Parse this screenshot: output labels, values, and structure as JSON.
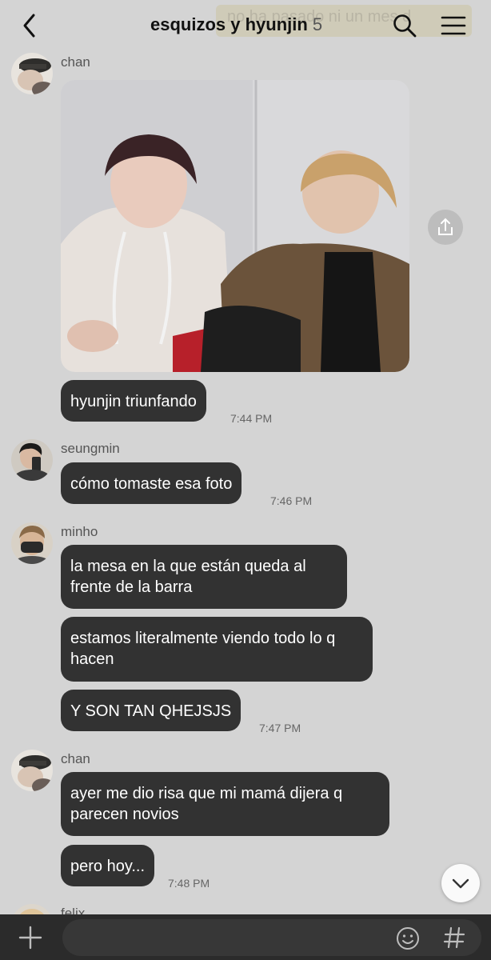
{
  "header": {
    "title": "esquizos y hyunjin",
    "member_count": "5",
    "ghost_text": "no ha pasado ni un mes d"
  },
  "messages": [
    {
      "sender": "chan",
      "photo_alt": "photo",
      "text": "hyunjin triunfando",
      "time": "7:44 PM"
    },
    {
      "sender": "seungmin",
      "text": "cómo tomaste esa foto",
      "time": "7:46 PM"
    },
    {
      "sender": "minho",
      "texts": [
        "la mesa en la que están queda al frente de la barra",
        "estamos literalmente viendo todo lo q hacen",
        "Y SON TAN QHEJSJS"
      ],
      "time": "7:47 PM"
    },
    {
      "sender": "chan",
      "texts": [
        "ayer me dio risa que mi mamá dijera q parecen novios",
        "pero hoy..."
      ],
      "time": "7:48 PM"
    },
    {
      "sender": "felix"
    }
  ],
  "input": {
    "placeholder": ""
  },
  "icons": {
    "back": "chevron-left-icon",
    "search": "search-icon",
    "menu": "hamburger-menu-icon",
    "share": "share-icon",
    "scroll": "chevron-down-icon",
    "plus": "plus-icon",
    "emoji": "emoji-icon",
    "hash": "hashtag-icon"
  },
  "colors": {
    "background": "#d4d4d4",
    "bubble": "#323232",
    "bubble_text": "#ffffff",
    "input_bar": "#2b2b2b"
  }
}
